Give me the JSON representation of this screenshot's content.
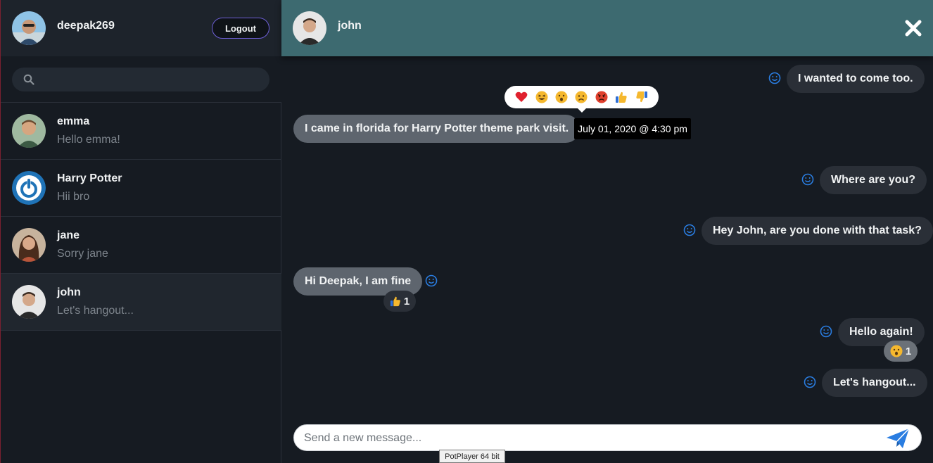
{
  "sidebar": {
    "user": {
      "name": "deepak269"
    },
    "logout_label": "Logout",
    "search": {
      "placeholder": ""
    },
    "contacts": [
      {
        "name": "emma",
        "last_message": "Hello emma!"
      },
      {
        "name": "Harry Potter",
        "last_message": "Hii bro"
      },
      {
        "name": "jane",
        "last_message": "Sorry jane"
      },
      {
        "name": "john",
        "last_message": "Let's hangout..."
      }
    ]
  },
  "chat": {
    "contact_name": "john",
    "messages": [
      {
        "text": "I wanted to come too.",
        "direction": "sent"
      },
      {
        "text": "I came in florida for Harry Potter theme park visit.",
        "direction": "received",
        "timestamp": "July 01, 2020 @ 4:30 pm"
      },
      {
        "text": "Where are you?",
        "direction": "sent"
      },
      {
        "text": "Hey John, are you done with that task?",
        "direction": "sent"
      },
      {
        "text": "Hi Deepak, I am fine",
        "direction": "received",
        "reaction": {
          "icon": "thumbs-up-icon",
          "count": "1"
        }
      },
      {
        "text": "Hello again!",
        "direction": "sent",
        "reaction": {
          "icon": "surprised-face-icon",
          "count": "1"
        }
      },
      {
        "text": "Let's hangout...",
        "direction": "sent"
      }
    ],
    "reaction_picker": [
      "heart-icon",
      "laughing-face-icon",
      "surprised-face-icon",
      "sad-face-icon",
      "angry-face-icon",
      "thumbs-up-icon",
      "thumbs-down-icon"
    ],
    "composer": {
      "placeholder": "Send a new message..."
    }
  },
  "system_tooltip": "PotPlayer 64 bit",
  "colors": {
    "header": "#3d6a70",
    "background": "#161b22",
    "accent": "#2a7de1",
    "logout_border": "#6d5fd6"
  }
}
